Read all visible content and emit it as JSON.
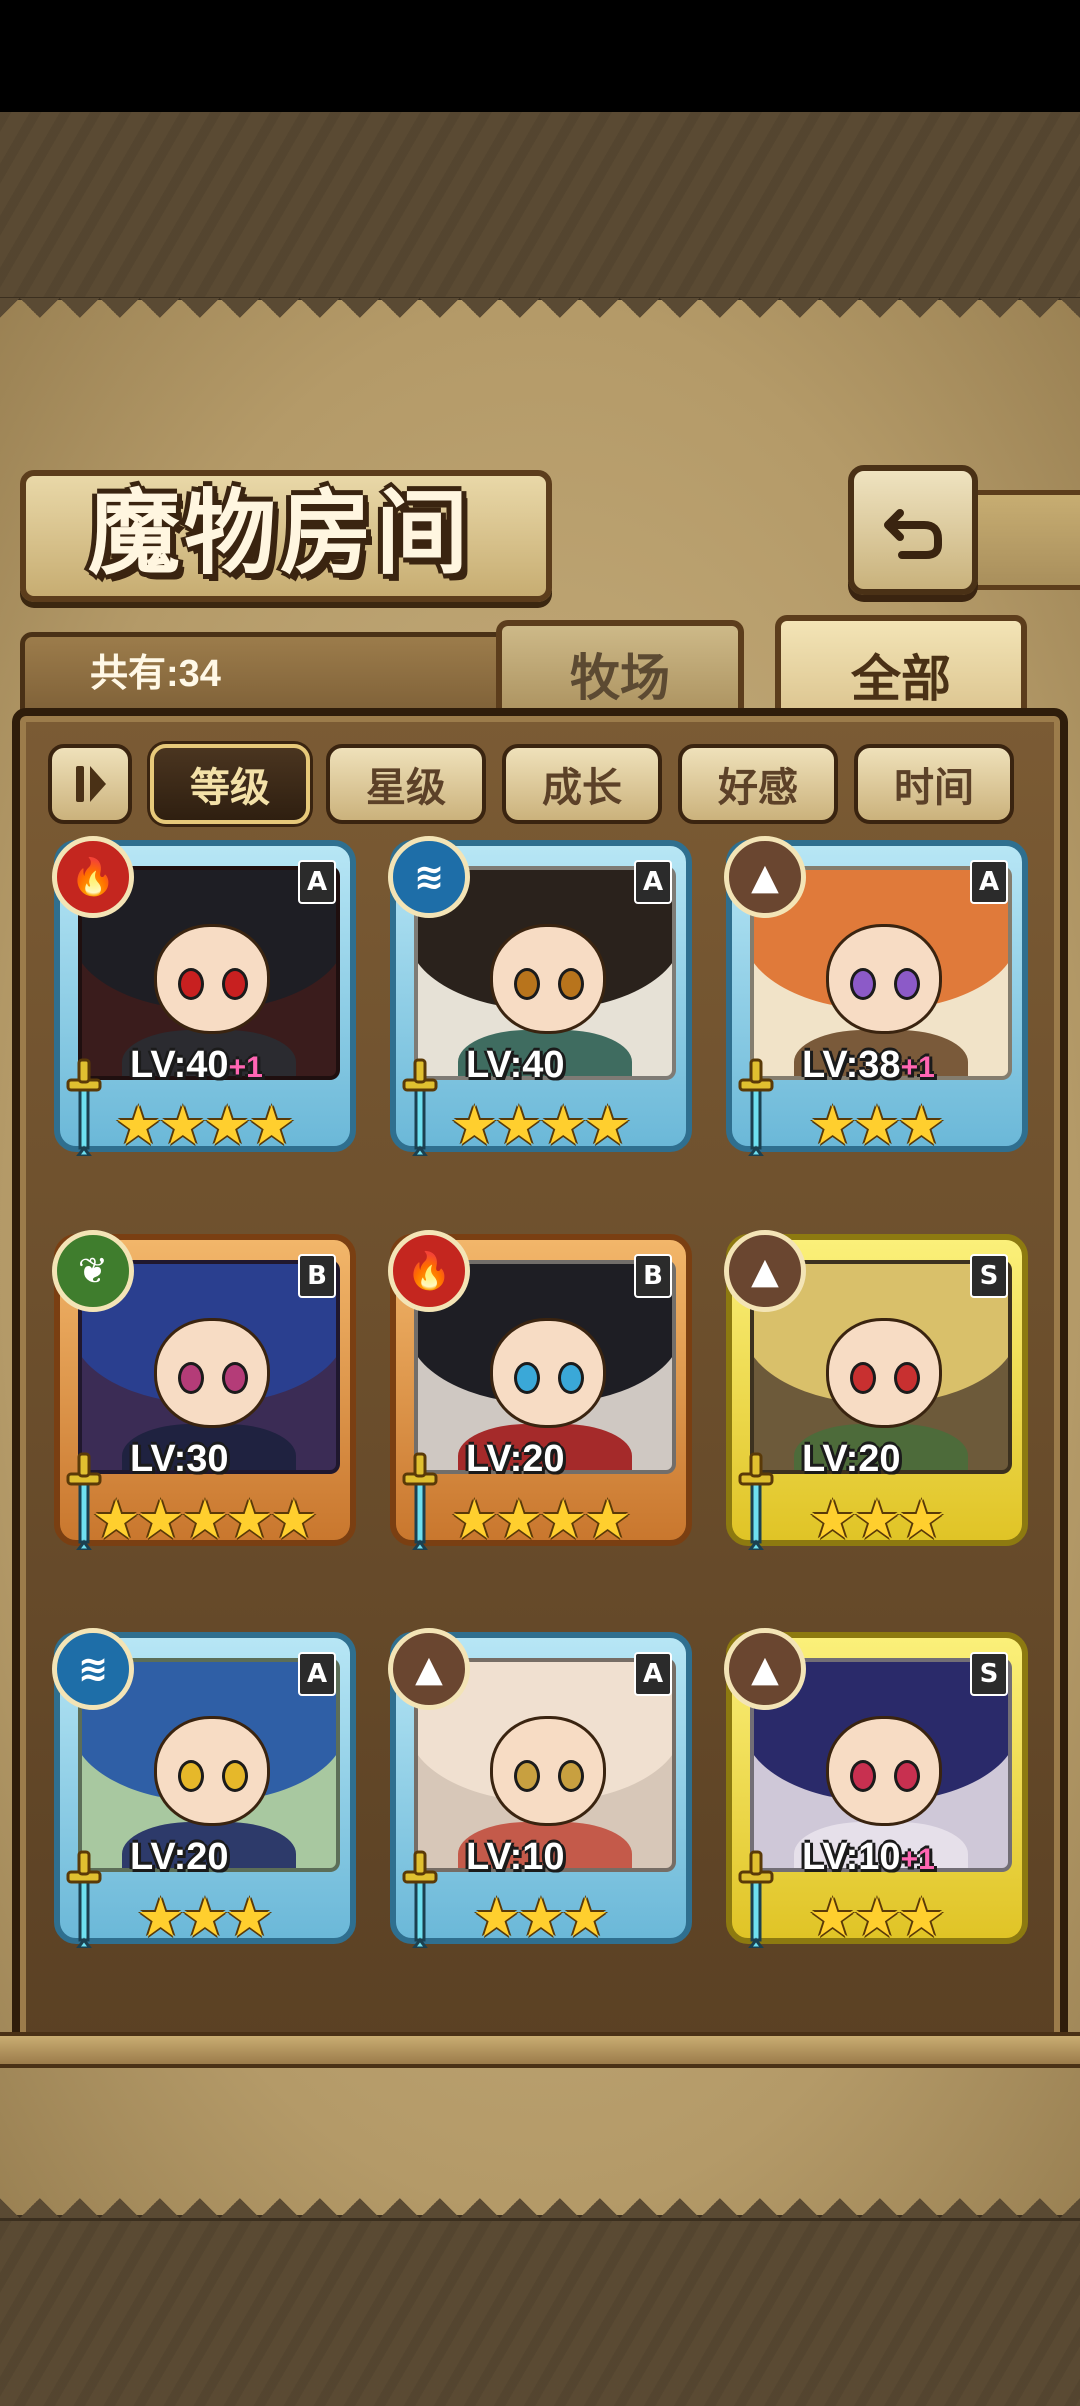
{
  "header": {
    "title": "魔物房间",
    "back_icon": "back-arrow-icon"
  },
  "tabs": {
    "count_label": "共有:34",
    "items": [
      {
        "label": "牧场",
        "active": false
      },
      {
        "label": "全部",
        "active": true
      }
    ]
  },
  "sort": {
    "toggle_icon": "pause-sort-icon",
    "buttons": [
      {
        "label": "等级",
        "active": true
      },
      {
        "label": "星级",
        "active": false
      },
      {
        "label": "成长",
        "active": false
      },
      {
        "label": "好感",
        "active": false
      },
      {
        "label": "时间",
        "active": false
      }
    ]
  },
  "monsters": [
    {
      "level": "LV:40",
      "bonus": "+1",
      "stars": 4,
      "rank": "A",
      "element": "fire"
    },
    {
      "level": "LV:40",
      "bonus": "",
      "stars": 4,
      "rank": "A",
      "element": "water"
    },
    {
      "level": "LV:38",
      "bonus": "+1",
      "stars": 3,
      "rank": "A",
      "element": "earth"
    },
    {
      "level": "LV:30",
      "bonus": "",
      "stars": 5,
      "rank": "B",
      "element": "nature"
    },
    {
      "level": "LV:20",
      "bonus": "",
      "stars": 4,
      "rank": "B",
      "element": "fire"
    },
    {
      "level": "LV:20",
      "bonus": "",
      "stars": 3,
      "rank": "S",
      "element": "earth"
    },
    {
      "level": "LV:20",
      "bonus": "",
      "stars": 3,
      "rank": "A",
      "element": "water"
    },
    {
      "level": "LV:10",
      "bonus": "",
      "stars": 3,
      "rank": "A",
      "element": "earth"
    },
    {
      "level": "LV:10",
      "bonus": "+1",
      "stars": 3,
      "rank": "S",
      "element": "earth"
    }
  ]
}
